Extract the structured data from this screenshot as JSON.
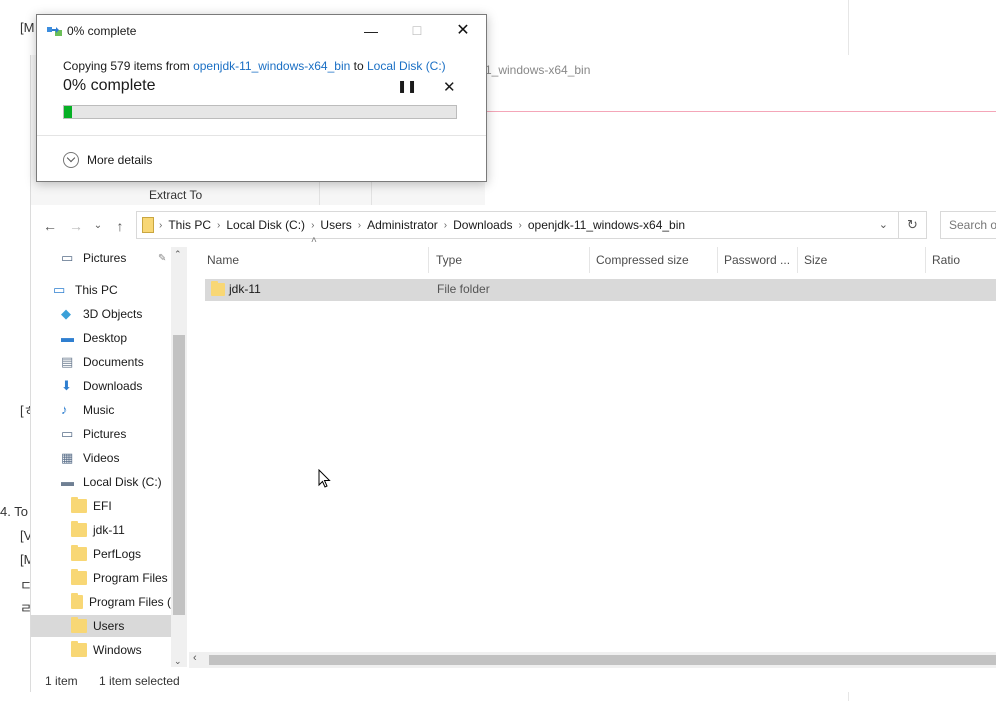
{
  "background_doc": {
    "fragments": [
      "[M",
      "[ㅎ",
      "4. To",
      "[V",
      "[M",
      "ㄷ",
      "ㄹ"
    ],
    "ribbon_tab": "Extract To",
    "path_tail": "1_windows-x64_bin"
  },
  "dialog": {
    "title": "0% complete",
    "copy_prefix": "Copying 579 items from",
    "source": "openjdk-11_windows-x64_bin",
    "copy_to": "to",
    "destination": "Local Disk (C:)",
    "status": "0% complete",
    "progress_pct": 2,
    "more_details": "More details",
    "colors": {
      "progress": "#06b025",
      "link": "#1a6fc4"
    }
  },
  "explorer": {
    "breadcrumbs": [
      "This PC",
      "Local Disk (C:)",
      "Users",
      "Administrator",
      "Downloads",
      "openjdk-11_windows-x64_bin"
    ],
    "search_placeholder": "Search op",
    "nav_items": [
      {
        "label": "Pictures",
        "icon": "pictures-icon"
      },
      {
        "label": "This PC",
        "icon": "computer-icon"
      },
      {
        "label": "3D Objects",
        "icon": "3d-objects-icon"
      },
      {
        "label": "Desktop",
        "icon": "desktop-icon"
      },
      {
        "label": "Documents",
        "icon": "documents-icon"
      },
      {
        "label": "Downloads",
        "icon": "downloads-icon"
      },
      {
        "label": "Music",
        "icon": "music-icon"
      },
      {
        "label": "Pictures",
        "icon": "pictures-icon"
      },
      {
        "label": "Videos",
        "icon": "videos-icon"
      },
      {
        "label": "Local Disk (C:)",
        "icon": "drive-icon"
      },
      {
        "label": "EFI",
        "icon": "folder-icon"
      },
      {
        "label": "jdk-11",
        "icon": "folder-icon"
      },
      {
        "label": "PerfLogs",
        "icon": "folder-icon"
      },
      {
        "label": "Program Files",
        "icon": "folder-icon"
      },
      {
        "label": "Program Files (",
        "icon": "folder-icon"
      },
      {
        "label": "Users",
        "icon": "folder-icon"
      },
      {
        "label": "Windows",
        "icon": "folder-icon"
      }
    ],
    "columns": [
      "Name",
      "Type",
      "Compressed size",
      "Password ...",
      "Size",
      "Ratio"
    ],
    "rows": [
      {
        "name": "jdk-11",
        "type": "File folder"
      }
    ],
    "status": {
      "count": "1 item",
      "selected": "1 item selected"
    }
  }
}
